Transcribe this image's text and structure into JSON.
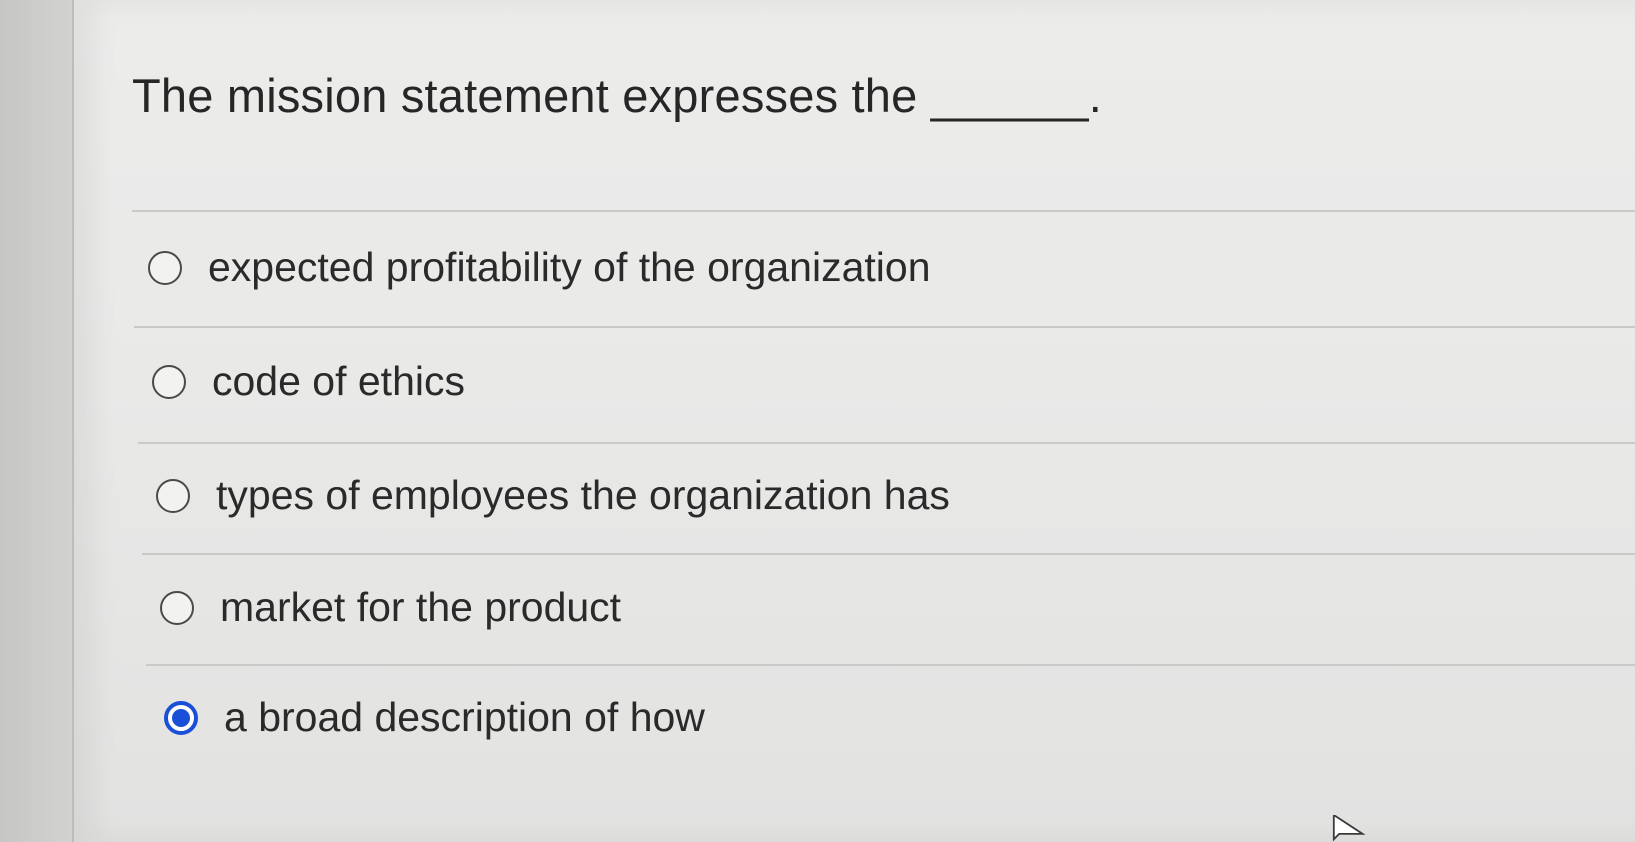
{
  "question": {
    "text": "The mission statement expresses the ______."
  },
  "options": [
    {
      "label": "expected profitability of the organization",
      "selected": false
    },
    {
      "label": "code of ethics",
      "selected": false
    },
    {
      "label": "types of employees the organization has",
      "selected": false
    },
    {
      "label": "market for the product",
      "selected": false
    },
    {
      "label": "a broad description of how",
      "selected": true
    }
  ],
  "colors": {
    "selected_radio": "#1a4fd8",
    "page_background": "#eaeae9"
  },
  "icons": {
    "radio_unselected": "radio-unchecked-icon",
    "radio_selected": "radio-checked-icon",
    "pointer": "mouse-pointer-icon"
  }
}
